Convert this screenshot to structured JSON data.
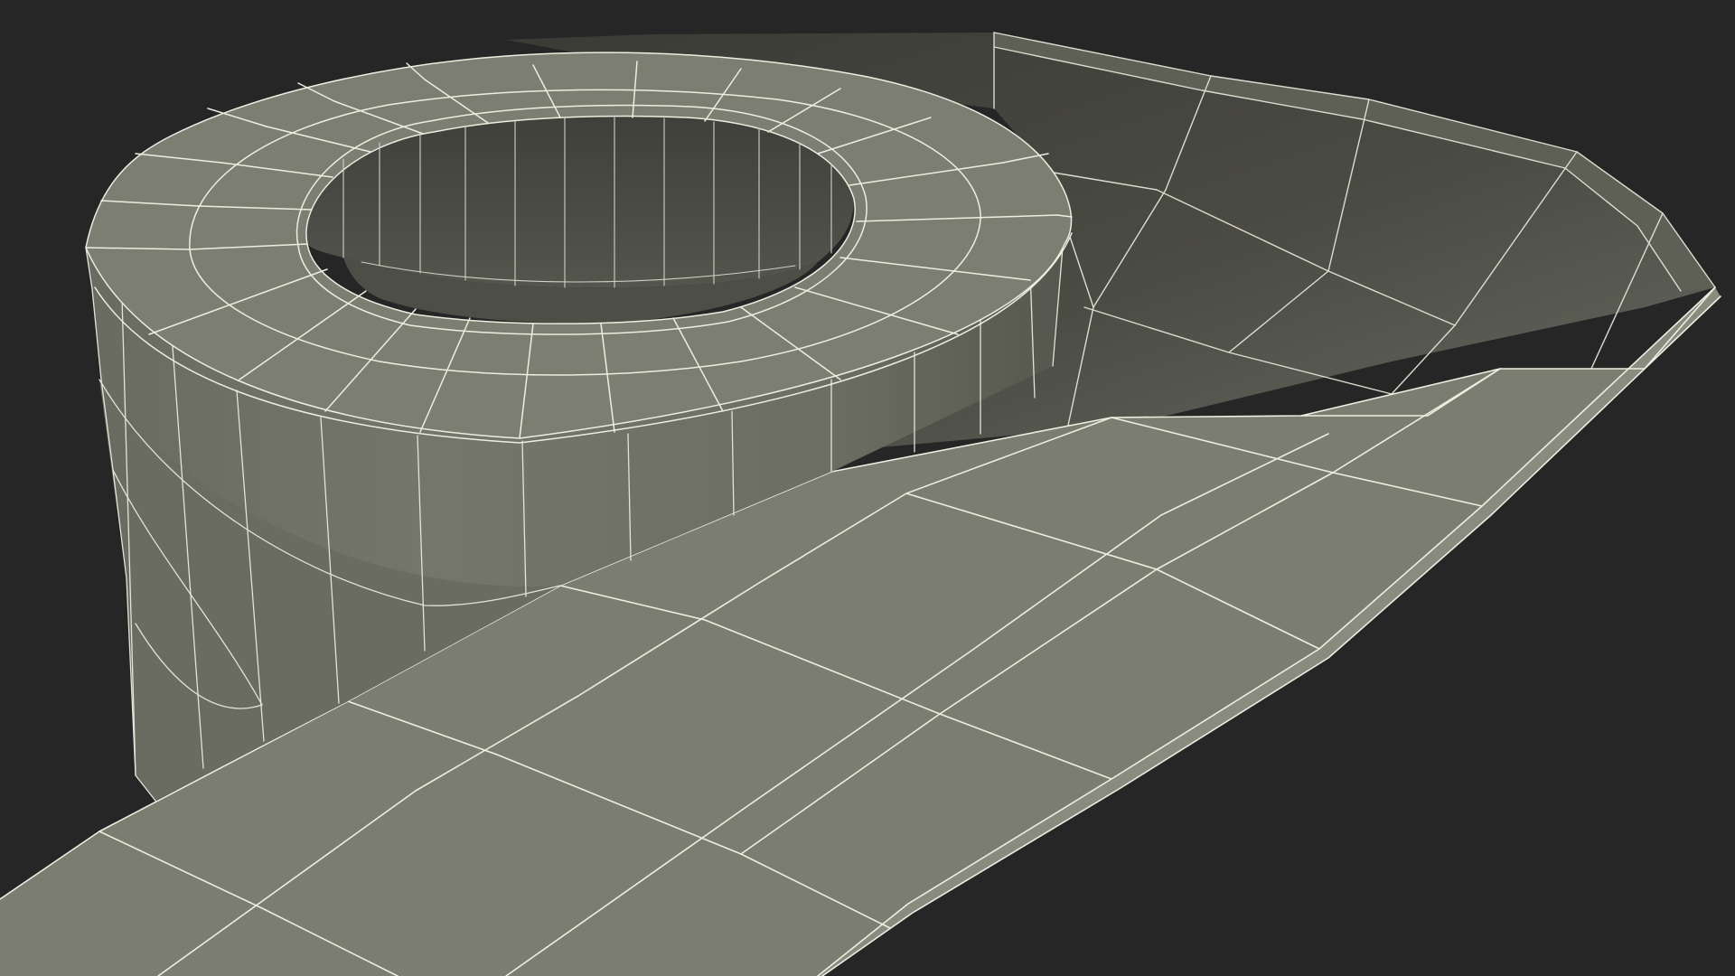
{
  "scene": {
    "subject": "wireframe-mesh-render",
    "description_visible_text": "",
    "colors": {
      "background": "#262626",
      "surface_light": "#7d7e72",
      "surface_mid": "#6e6f63",
      "surface_dark": "#3f403a",
      "surface_shadow": "#33342f",
      "wire": "#eceee0"
    }
  }
}
